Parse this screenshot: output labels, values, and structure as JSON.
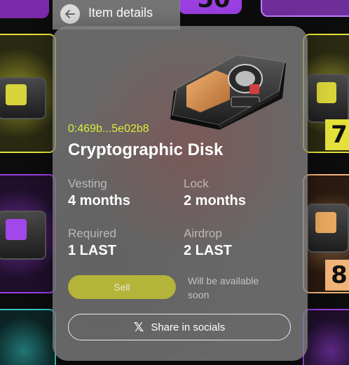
{
  "header": {
    "title": "Item details",
    "back_icon": "arrow-left-icon"
  },
  "item": {
    "id": "0:469b...5e02b8",
    "name": "Cryptographic Disk",
    "image_icon": "cryptographic-disk-image"
  },
  "stats": [
    {
      "label": "Vesting",
      "value": "4 months"
    },
    {
      "label": "Lock",
      "value": "2 months"
    },
    {
      "label": "Required",
      "value": "1 LAST"
    },
    {
      "label": "Airdrop",
      "value": "2 LAST"
    }
  ],
  "actions": {
    "sell_label": "Sell",
    "availability_note": "Will be available soon",
    "share_label": "Share in socials",
    "share_icon": "x-logo-icon"
  },
  "background_badges": [
    "50",
    "7",
    "8"
  ],
  "colors": {
    "accent_yellow": "#d8ec3a",
    "sell_button": "#b4b33a",
    "card_yellow": "#e3e13a",
    "card_purple": "#9b3fe0",
    "card_orange": "#f0b478",
    "card_cyan": "#35c7c7"
  }
}
